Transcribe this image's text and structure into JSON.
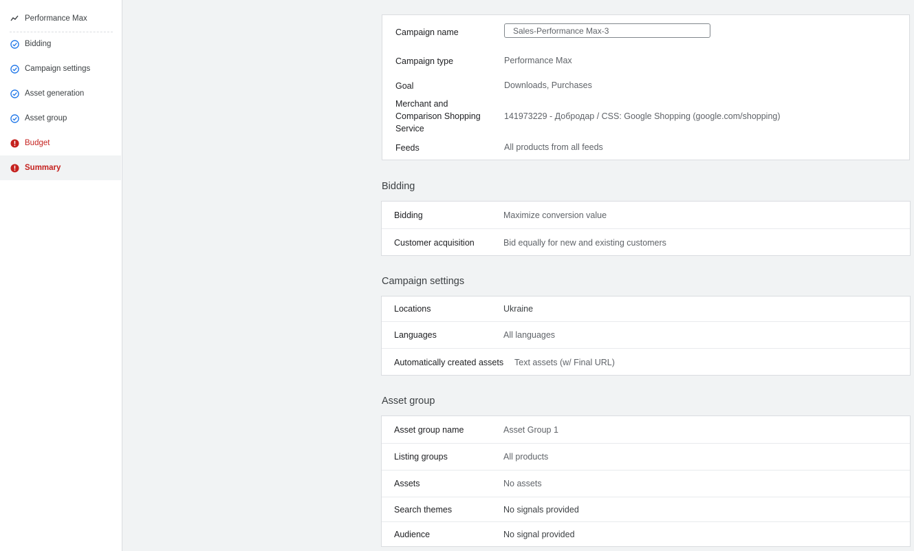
{
  "sidebar": {
    "items": [
      {
        "label": "Performance Max",
        "icon": "trend-icon"
      },
      {
        "label": "Bidding",
        "icon": "check-circle-icon"
      },
      {
        "label": "Campaign settings",
        "icon": "check-circle-icon"
      },
      {
        "label": "Asset generation",
        "icon": "check-circle-icon"
      },
      {
        "label": "Asset group",
        "icon": "check-circle-icon"
      },
      {
        "label": "Budget",
        "icon": "error-icon"
      },
      {
        "label": "Summary",
        "icon": "error-icon"
      }
    ]
  },
  "overview": {
    "campaign_name_label": "Campaign name",
    "campaign_name_value": "Sales-Performance Max-3",
    "campaign_type_label": "Campaign type",
    "campaign_type_value": "Performance Max",
    "goal_label": "Goal",
    "goal_value": "Downloads, Purchases",
    "merchant_label_1": "Merchant and",
    "merchant_label_2": "Comparison Shopping",
    "merchant_label_3": "Service",
    "merchant_value": "141973229 - Добродар / CSS: Google Shopping (google.com/shopping)",
    "feeds_label": "Feeds",
    "feeds_value": "All products from all feeds"
  },
  "bidding": {
    "title": "Bidding",
    "rows": [
      {
        "label": "Bidding",
        "value": "Maximize conversion value"
      },
      {
        "label": "Customer acquisition",
        "value": "Bid equally for new and existing customers"
      }
    ]
  },
  "campaign_settings": {
    "title": "Campaign settings",
    "rows": [
      {
        "label": "Locations",
        "value": "Ukraine"
      },
      {
        "label": "Languages",
        "value": "All languages"
      },
      {
        "label": "Automatically created assets",
        "value": "Text assets (w/ Final URL)"
      }
    ]
  },
  "asset_group": {
    "title": "Asset group",
    "rows": [
      {
        "label": "Asset group name",
        "value": "Asset Group 1"
      },
      {
        "label": "Listing groups",
        "value": "All products"
      },
      {
        "label": "Assets",
        "value": "No assets"
      },
      {
        "label": "Search themes",
        "value": "No signals provided"
      },
      {
        "label": "Audience",
        "value": "No signal provided"
      }
    ]
  },
  "colors": {
    "check": "#1a73e8",
    "error": "#c5221f"
  }
}
